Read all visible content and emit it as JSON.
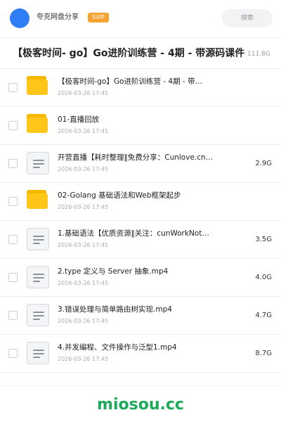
{
  "topbar": {
    "share_title": "夸克网盘分享",
    "badge": "SVIP",
    "search_label": "搜索",
    "accent_color": "#2f7ef5"
  },
  "header": {
    "title": "【极客时间- go】Go进阶训练营 - 4期 - 带源码课件",
    "size": "111.8G"
  },
  "files": [
    {
      "type": "folder",
      "icon": "folder-icon",
      "name": "【极客时间-go】Go进阶训练营 - 4期 - 带…",
      "date": "2026-03-26 17:45",
      "size": ""
    },
    {
      "type": "folder",
      "icon": "folder-icon",
      "name": "01-直播回放",
      "date": "2026-03-26 17:45",
      "size": ""
    },
    {
      "type": "file",
      "icon": "document-icon",
      "name": "开营直播【耗时整理‖免费分享：Cunlove.cn…",
      "date": "2026-03-26 17:45",
      "size": "2.9G"
    },
    {
      "type": "folder",
      "icon": "folder-icon",
      "name": "02-Golang 基础语法和Web框架起步",
      "date": "2026-03-26 17:45",
      "size": ""
    },
    {
      "type": "file",
      "icon": "document-icon",
      "name": "1.基础语法【优质资源‖关注：cunWorkNot…",
      "date": "2026-03-26 17:45",
      "size": "3.5G"
    },
    {
      "type": "file",
      "icon": "document-icon",
      "name": "2.type 定义与 Server 抽象.mp4",
      "date": "2026-03-26 17:45",
      "size": "4.0G"
    },
    {
      "type": "file",
      "icon": "document-icon",
      "name": "3.错误处理与简单路由树实现.mp4",
      "date": "2026-03-26 17:45",
      "size": "4.7G"
    },
    {
      "type": "file",
      "icon": "document-icon",
      "name": "4.并发编程、文件操作与泛型1.mp4",
      "date": "2026-03-26 17:45",
      "size": "8.7G"
    }
  ],
  "footer": {
    "brand": "miosou.cc",
    "brand_color": "#1ca95a"
  }
}
